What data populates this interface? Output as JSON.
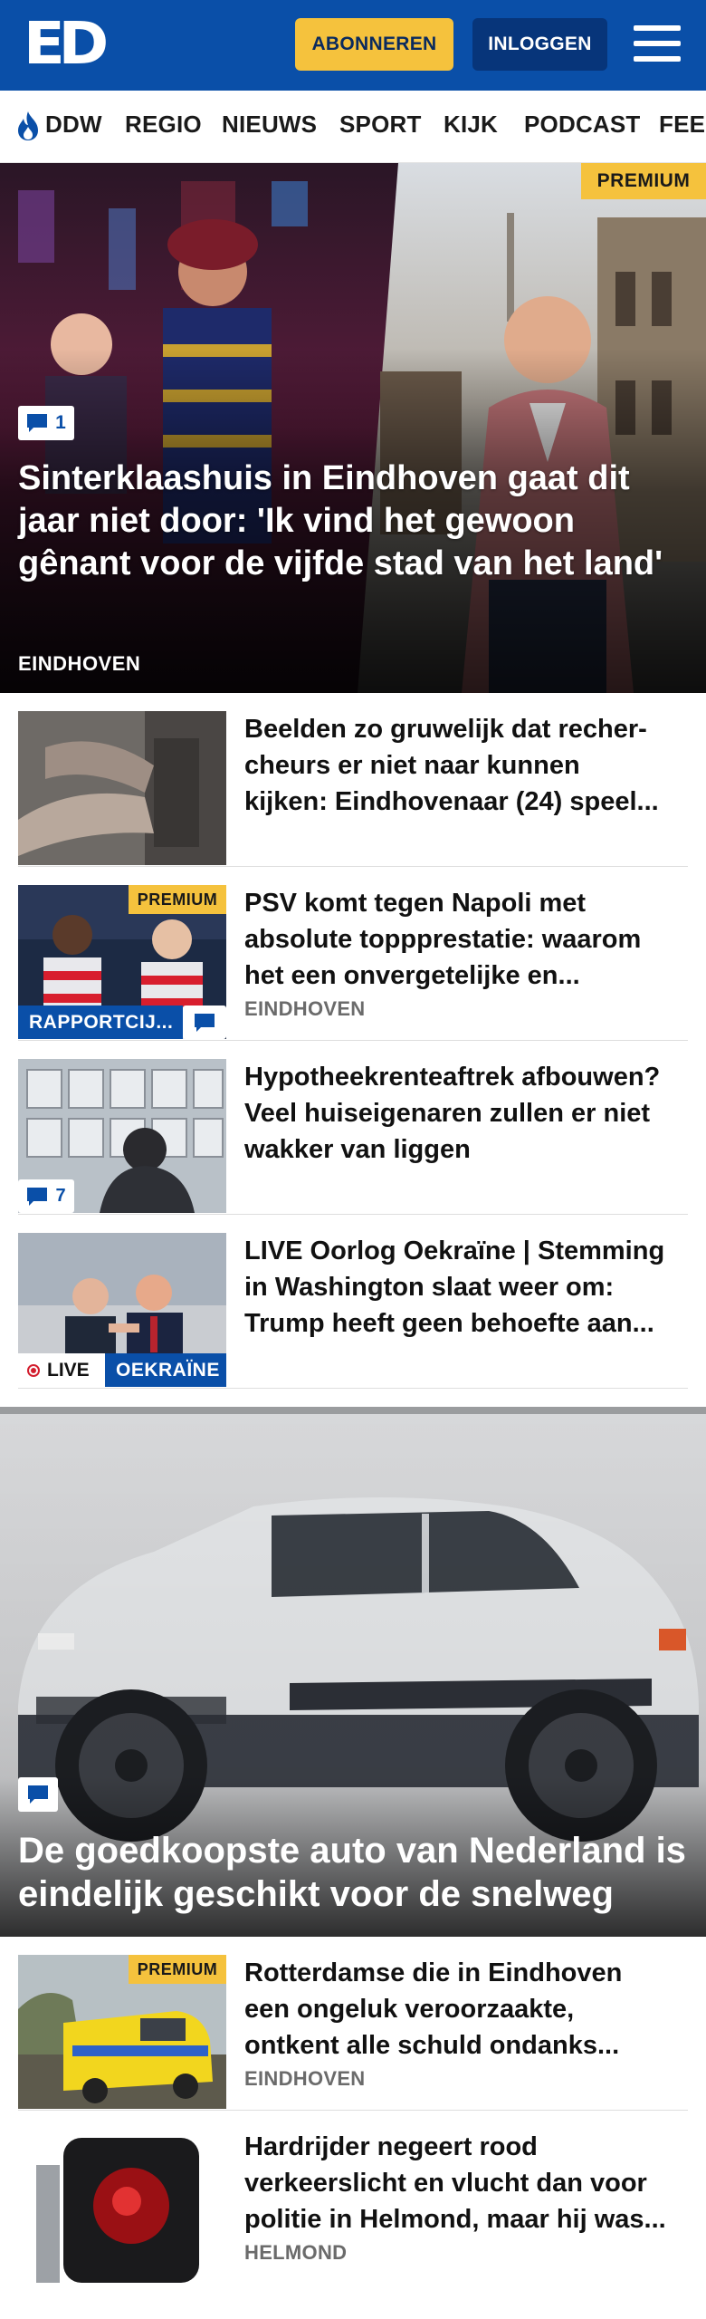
{
  "header": {
    "logo_text": "ED",
    "subscribe_label": "ABONNEREN",
    "login_label": "INLOGGEN",
    "brand_color": "#0a4fa8",
    "accent_color": "#f5c23d"
  },
  "nav": {
    "items": [
      "DDW",
      "REGIO",
      "NIEUWS",
      "SPORT",
      "KIJK",
      "PODCAST",
      "FEE"
    ]
  },
  "hero": {
    "premium_label": "PREMIUM",
    "comment_count": "1",
    "title": "Sinterklaashuis in Eindhoven gaat dit jaar niet door: 'Ik vind het gewoon gênant voor de vijfde stad van het land'",
    "city": "EINDHOVEN"
  },
  "articles": [
    {
      "title": "Beelden zo gruwelijk dat recher­cheurs er niet naar kunnen kijken: Eindhovenaar (24) speel...",
      "meta": ""
    },
    {
      "title": "PSV komt tegen Napoli met absolute toppprestatie: waarom het een onvergetelijke en...",
      "meta": "EINDHOVEN",
      "premium_label": "PREMIUM",
      "section_label": "RAPPORTCIJ..."
    },
    {
      "title": "Hypotheekrenteaftrek afbouwen? Veel huiseigenaren zullen er niet wakker van liggen",
      "meta": "",
      "comment_count": "7"
    },
    {
      "title": "LIVE Oorlog Oekraïne | Stemming in Washington slaat weer om: Trump heeft geen behoefte aan...",
      "meta": "",
      "live_label": "LIVE",
      "section_label": "OEKRAÏNE"
    }
  ],
  "feature": {
    "title": "De goedkoopste auto van Nederland is eindelijk geschikt voor de snelweg"
  },
  "articles2": [
    {
      "title": "Rotterdamse die in Eindhoven een ongeluk veroorzaakte, ontkent alle schuld ondanks...",
      "meta": "EINDHOVEN",
      "premium_label": "PREMIUM"
    },
    {
      "title": "Hardrijder negeert rood verkeerslicht en vlucht dan voor politie in Helmond, maar hij was...",
      "meta": "HELMOND"
    }
  ]
}
